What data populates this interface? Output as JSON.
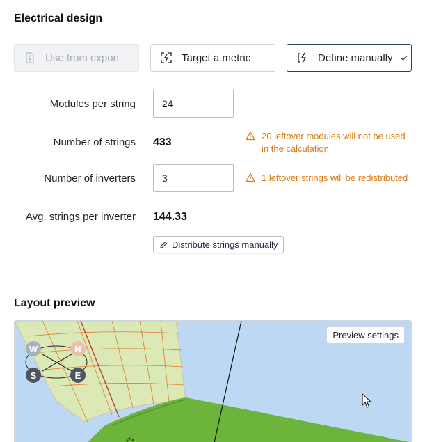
{
  "electrical": {
    "title": "Electrical design",
    "modes": [
      {
        "label": "Use from export",
        "icon": "bolt-doc-icon",
        "state": "disabled"
      },
      {
        "label": "Target a metric",
        "icon": "target-bolt-icon",
        "state": "default"
      },
      {
        "label": "Define manually",
        "icon": "manual-bolt-icon",
        "state": "selected"
      }
    ],
    "modules_per_string": {
      "label": "Modules per string",
      "value": "24"
    },
    "number_of_strings": {
      "label": "Number of strings",
      "value": "433",
      "warning": "20 leftover modules will not be used in the calculation"
    },
    "number_of_inverters": {
      "label": "Number of inverters",
      "value": "3",
      "warning": "1 leftover strings will be redistributed"
    },
    "avg_strings": {
      "label": "Avg. strings per inverter",
      "value": "144.33"
    },
    "distribute_button": "Distribute strings manually"
  },
  "layout_preview": {
    "title": "Layout preview",
    "settings_button": "Preview settings",
    "compass": {
      "w": "W",
      "n": "N",
      "s": "S",
      "e": "E"
    }
  },
  "colors": {
    "accent": "#2c3e66",
    "warning": "#d97a12",
    "sky": "#bcd8f2",
    "terrain": "#dbe9b6",
    "roof": "#6cb43a"
  }
}
